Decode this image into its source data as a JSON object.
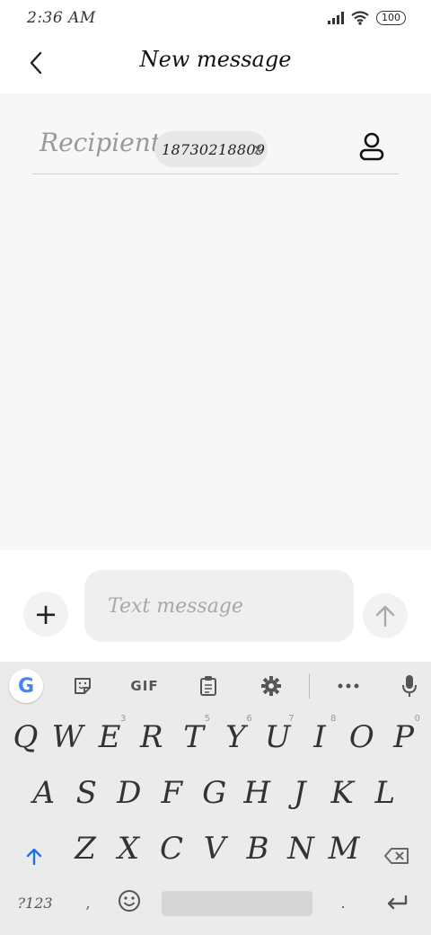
{
  "status_bar": {
    "time": "2:36 AM",
    "battery": "100"
  },
  "header": {
    "title": "New message"
  },
  "recipient": {
    "label": "Recipient:",
    "chip_number": "18730218809",
    "chip_remove": "x"
  },
  "compose": {
    "placeholder": "Text message",
    "add_label": "+"
  },
  "keyboard": {
    "toolbar": {
      "google": "G",
      "gif": "GIF"
    },
    "row1": [
      {
        "key": "Q",
        "hint": ""
      },
      {
        "key": "W",
        "hint": ""
      },
      {
        "key": "E",
        "hint": "3"
      },
      {
        "key": "R",
        "hint": ""
      },
      {
        "key": "T",
        "hint": "5"
      },
      {
        "key": "Y",
        "hint": "6"
      },
      {
        "key": "U",
        "hint": "7"
      },
      {
        "key": "I",
        "hint": "8"
      },
      {
        "key": "O",
        "hint": ""
      },
      {
        "key": "P",
        "hint": "0"
      }
    ],
    "row2": [
      "A",
      "S",
      "D",
      "F",
      "G",
      "H",
      "J",
      "K",
      "L"
    ],
    "row3": [
      "Z",
      "X",
      "C",
      "V",
      "B",
      "N",
      "M"
    ],
    "symbols_label": "?123",
    "comma": ",",
    "period": "."
  },
  "colors": {
    "accent": "#1a73e8",
    "keyboard_bg": "#ebebeb",
    "content_bg": "#f7f7f7"
  },
  "icons": [
    "back-arrow-icon",
    "contact-icon",
    "plus-icon",
    "send-arrow-icon",
    "google-icon",
    "sticker-icon",
    "clipboard-icon",
    "gear-icon",
    "more-icon",
    "mic-icon",
    "shift-icon",
    "backspace-icon",
    "emoji-icon",
    "enter-icon",
    "wifi-icon",
    "signal-icon"
  ]
}
